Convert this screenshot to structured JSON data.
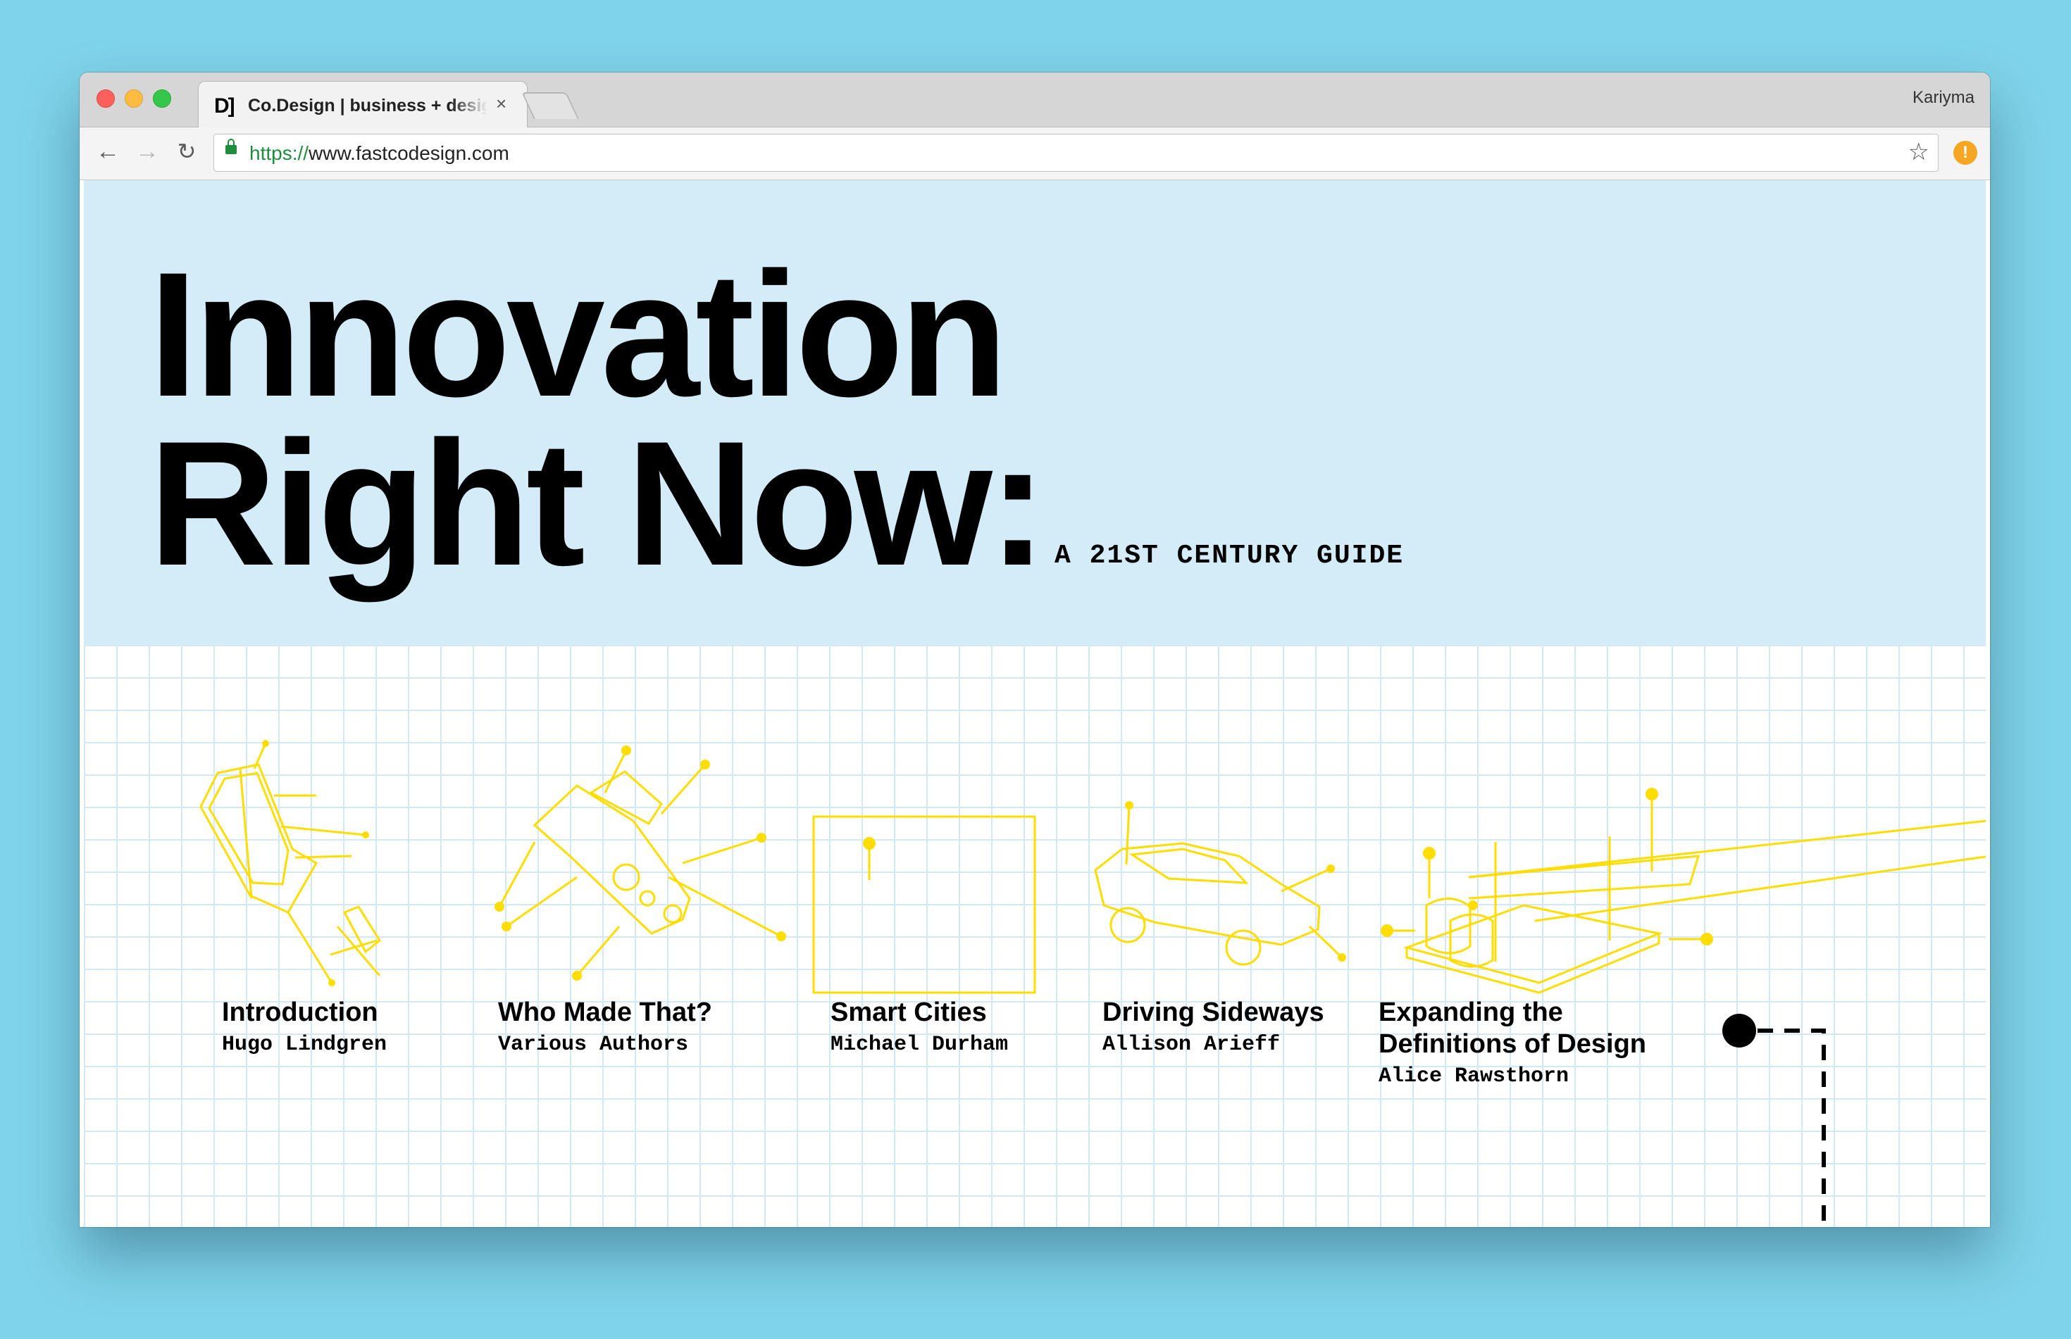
{
  "browser": {
    "tab_title": "Co.Design | business + design",
    "tab_favicon": "D]",
    "tab_close": "×",
    "profile_name": "Kariyma",
    "url_scheme": "https://",
    "url_host": "www.fastcodesign.com",
    "icons": {
      "back": "back-arrow-icon",
      "forward": "forward-arrow-icon",
      "reload": "reload-icon",
      "lock": "lock-icon",
      "bookmark": "star-icon",
      "extension": "alert-icon"
    }
  },
  "hero": {
    "headline_line1": "Innovation",
    "headline_line2": "Right Now:",
    "subtitle": "A 21ST CENTURY GUIDE",
    "background": "#d3ecf8"
  },
  "sections": [
    {
      "title": "Introduction",
      "author": "Hugo Lindgren"
    },
    {
      "title": "Who Made That?",
      "author": "Various Authors"
    },
    {
      "title": "Smart Cities",
      "author": "Michael Durham"
    },
    {
      "title": "Driving Sideways",
      "author": "Allison Arieff"
    },
    {
      "title_line1": "Expanding the",
      "title_line2": "Definitions of  Design",
      "author": "Alice Rawsthorn"
    }
  ],
  "colors": {
    "illustration": "#ffdd00",
    "grid": "#d2e8f4",
    "desktop": "#7fd3ea"
  }
}
